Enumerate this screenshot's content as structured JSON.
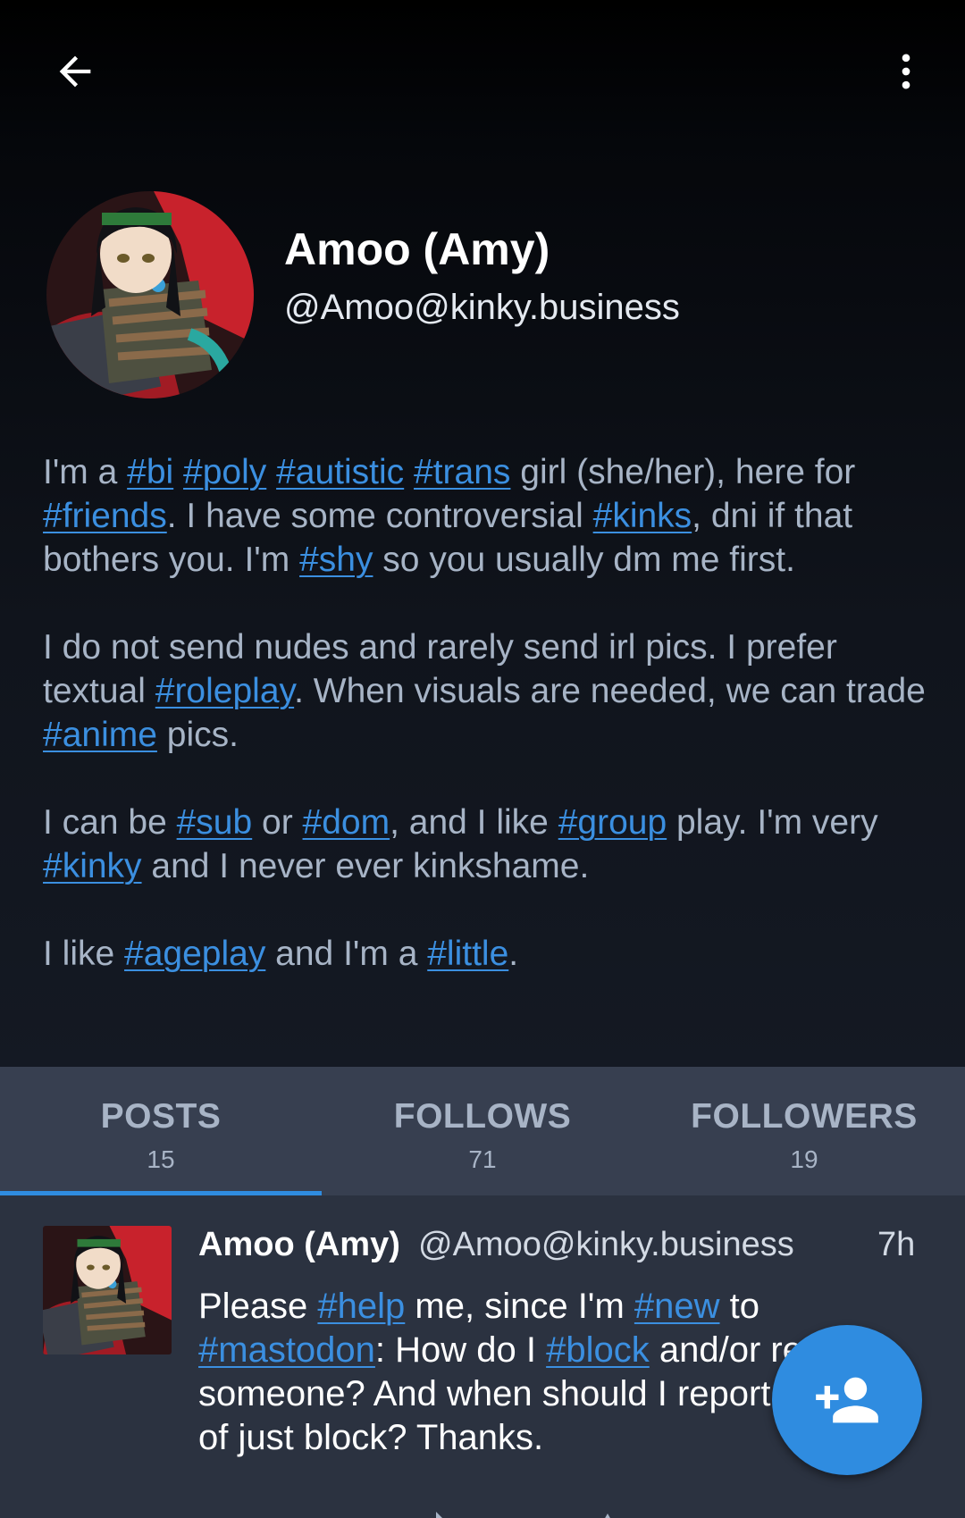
{
  "topbar": {
    "back_icon": "arrow-left-icon",
    "more_icon": "more-vertical-icon"
  },
  "profile": {
    "display_name": "Amoo (Amy)",
    "handle": "@Amoo@kinky.business",
    "bio": {
      "p1": {
        "t0": "I'm a ",
        "h_bi": "#bi",
        "s1": " ",
        "h_poly": "#poly",
        "s2": " ",
        "h_autistic": "#autistic",
        "s3": " ",
        "h_trans": "#trans",
        "t1": " girl (she/her), here for ",
        "h_friends": "#friends",
        "t2": ". I have some controversial ",
        "h_kinks": "#kinks",
        "t3": ", dni if that bothers you. I'm ",
        "h_shy": "#shy",
        "t4": " so you usually dm me first."
      },
      "p2": {
        "t0": "I do not send nudes and rarely send irl pics. I prefer textual ",
        "h_roleplay": "#roleplay",
        "t1": ". When visuals are needed, we can trade ",
        "h_anime": "#anime",
        "t2": " pics."
      },
      "p3": {
        "t0": "I can be ",
        "h_sub": "#sub",
        "t1": " or ",
        "h_dom": "#dom",
        "t2": ", and I like ",
        "h_group": "#group",
        "t3": " play. I'm very ",
        "h_kinky": "#kinky",
        "t4": " and I never ever kinkshame."
      },
      "p4": {
        "t0": "I like ",
        "h_ageplay": "#ageplay",
        "t1": " and I'm a ",
        "h_little": "#little",
        "t2": "."
      }
    }
  },
  "tabs": [
    {
      "label": "POSTS",
      "count": "15",
      "active": true
    },
    {
      "label": "FOLLOWS",
      "count": "71",
      "active": false
    },
    {
      "label": "FOLLOWERS",
      "count": "19",
      "active": false
    }
  ],
  "status": {
    "display_name": "Amoo (Amy)",
    "handle": "@Amoo@kinky.business",
    "time": "7h",
    "content": {
      "t0": "Please ",
      "h_help": "#help",
      "t1": " me, since I'm ",
      "h_new": "#new",
      "t2": " to ",
      "h_mastodon": "#mastodon",
      "t3": ": How do I ",
      "h_block": "#block",
      "t4": " and/or report someone? And when should I report instead of just block? Thanks."
    }
  },
  "fab": {
    "icon": "add-person-icon"
  },
  "colors": {
    "accent": "#2f8ce0",
    "link": "#3b8fe0",
    "tab_bar": "#373f50",
    "status_bg": "#2b3240"
  }
}
